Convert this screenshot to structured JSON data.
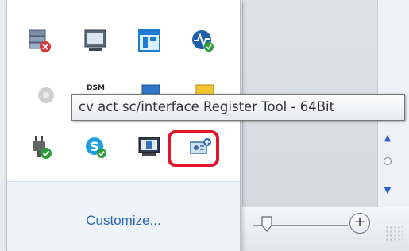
{
  "tooltip": {
    "text": "cv act sc/interface Register Tool - 64Bit"
  },
  "tray": {
    "customize_label": "Customize...",
    "icons_row1": [
      "server-error-icon",
      "monitor-window-icon",
      "app-tiles-icon",
      "network-check-icon"
    ],
    "icons_row2": [
      "gear-icon",
      "dsm-icon",
      "blue-app-icon",
      "yellow-app-icon"
    ],
    "icons_row2_text": {
      "dsm": "DSM"
    },
    "icons_row3": [
      "plug-check-icon",
      "skype-icon",
      "monitor-device-icon",
      "register-tool-icon"
    ],
    "highlighted_icon": "register-tool-icon"
  },
  "colors": {
    "highlight": "#e2162a",
    "link": "#2a69b8"
  },
  "statusbar": {
    "zoom_plus": "+"
  }
}
